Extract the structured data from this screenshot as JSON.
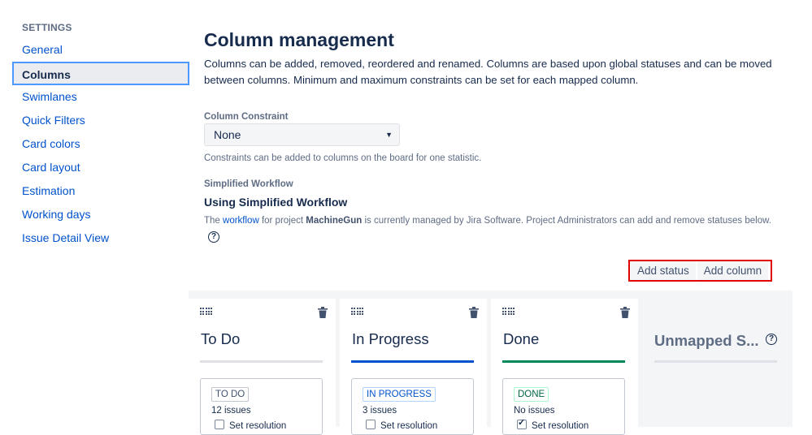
{
  "sidebar": {
    "heading": "SETTINGS",
    "items": [
      {
        "label": "General",
        "active": false
      },
      {
        "label": "Columns",
        "active": true
      },
      {
        "label": "Swimlanes",
        "active": false
      },
      {
        "label": "Quick Filters",
        "active": false
      },
      {
        "label": "Card colors",
        "active": false
      },
      {
        "label": "Card layout",
        "active": false
      },
      {
        "label": "Estimation",
        "active": false
      },
      {
        "label": "Working days",
        "active": false
      },
      {
        "label": "Issue Detail View",
        "active": false
      }
    ]
  },
  "main": {
    "title": "Column management",
    "description": "Columns can be added, removed, reordered and renamed. Columns are based upon global statuses and can be moved between columns. Minimum and maximum constraints can be set for each mapped column.",
    "constraint": {
      "label": "Column Constraint",
      "selected": "None",
      "hint": "Constraints can be added to columns on the board for one statistic."
    },
    "workflow": {
      "label": "Simplified Workflow",
      "heading": "Using Simplified Workflow",
      "text_before": "The ",
      "link": "workflow",
      "text_mid": " for project ",
      "project": "MachineGun",
      "text_after": " is currently managed by Jira Software. Project Administrators can add and remove statuses below."
    },
    "buttons": {
      "add_status": "Add status",
      "add_column": "Add column"
    }
  },
  "board": {
    "columns": [
      {
        "title": "To Do",
        "bar_color": "#dfe1e6",
        "status": "TO DO",
        "status_color": "#42526e",
        "issues": "12 issues",
        "resolution": "Set resolution",
        "resolution_checked": false
      },
      {
        "title": "In Progress",
        "bar_color": "#0052cc",
        "status": "IN PROGRESS",
        "status_color": "#0052cc",
        "issues": "3 issues",
        "resolution": "Set resolution",
        "resolution_checked": false
      },
      {
        "title": "Done",
        "bar_color": "#00875a",
        "status": "DONE",
        "status_color": "#006644",
        "issues": "No issues",
        "resolution": "Set resolution",
        "resolution_checked": true
      }
    ],
    "unmapped_title": "Unmapped S..."
  }
}
